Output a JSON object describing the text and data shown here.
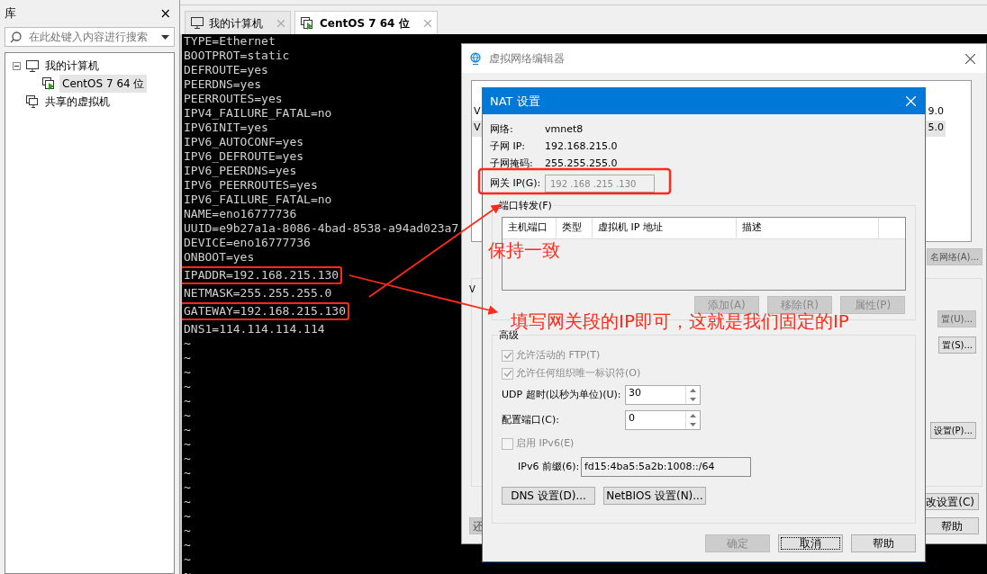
{
  "library": {
    "title": "库",
    "close": "×",
    "search_placeholder": "在此处键入内容进行搜索",
    "tree": [
      {
        "label": "我的计算机",
        "kind": "computer",
        "expanded": true,
        "selected": false,
        "children": [
          {
            "label": "CentOS 7 64 位",
            "kind": "vm",
            "selected": true
          }
        ]
      },
      {
        "label": "共享的虚拟机",
        "kind": "shared",
        "selected": false
      }
    ]
  },
  "tabs": [
    {
      "label": "我的计算机",
      "kind": "computer",
      "selected": false
    },
    {
      "label": "CentOS 7 64 位",
      "kind": "vm",
      "selected": true
    }
  ],
  "terminal": {
    "lines": [
      "TYPE=Ethernet",
      "BOOTPROT=static",
      "DEFROUTE=yes",
      "PEERDNS=yes",
      "PEERROUTES=yes",
      "IPV4_FAILURE_FATAL=no",
      "IPV6INIT=yes",
      "IPV6_AUTOCONF=yes",
      "IPV6_DEFROUTE=yes",
      "IPV6_PEERDNS=yes",
      "IPV6_PEERROUTES=yes",
      "IPV6_FAILURE_FATAL=no",
      "NAME=eno16777736",
      "UUID=e9b27a1a-8086-4bad-8538-a94ad023a7",
      "DEVICE=eno16777736",
      "ONBOOT=yes",
      {
        "text": "IPADDR=192.168.215.130",
        "highlighted": true
      },
      "NETMASK=255.255.255.0",
      {
        "text": "GATEWAY=192.168.215.130",
        "highlighted": true
      },
      "DNS1=114.114.114.114",
      "~",
      "~",
      "~",
      "~",
      "~",
      "~",
      "~",
      "~",
      "~",
      "~",
      "~",
      "~",
      "~",
      "~",
      "~",
      "~",
      "~"
    ]
  },
  "network_editor": {
    "title": "虚拟网络编辑器",
    "rows": [
      {
        "column_1": "V",
        "column_2": "9.0",
        "selected": false
      },
      {
        "column_1": "V",
        "column_2": "5.0",
        "selected": true
      }
    ],
    "rename_button": "名网络(A)...",
    "group_label": "V",
    "side_buttons": [
      "置(U)...",
      "置(S)...",
      "设置(P)..."
    ],
    "change_button": "改设置(C)",
    "help_button": "帮助",
    "restore_button": "还"
  },
  "nat_dialog": {
    "title": "NAT 设置",
    "info": [
      {
        "label": "网络:",
        "value": "vmnet8"
      },
      {
        "label": "子网 IP:",
        "value": "192.168.215.0"
      },
      {
        "label": "子网掩码:",
        "value": "255.255.255.0"
      }
    ],
    "gateway_label": "网关 IP(G):",
    "gateway_value": "192 .168 .215 .130",
    "forwarding_label": "端口转发(F)",
    "columns": [
      "主机端口",
      "类型",
      "虚拟机 IP 地址",
      "描述"
    ],
    "forwarding_buttons": [
      {
        "label": "添加(A)",
        "disabled": true
      },
      {
        "label": "移除(R)",
        "disabled": true
      },
      {
        "label": "属性(P)",
        "disabled": true
      }
    ],
    "advanced_label": "高级",
    "options": [
      {
        "label": "允许活动的 FTP(T)",
        "checked": true,
        "disabled": true
      },
      {
        "label": "允许任何组织唯一标识符(O)",
        "checked": true,
        "disabled": true
      }
    ],
    "spinners": [
      {
        "label": "UDP 超时(以秒为单位)(U):",
        "value": "30"
      },
      {
        "label": "配置端口(C):",
        "value": "0"
      }
    ],
    "ipv6": {
      "label": "启用 IPv6(E)",
      "checked": false,
      "disabled": true
    },
    "prefix_label": "IPv6 前缀(6):",
    "prefix_value": "fd15:4ba5:5a2b:1008::/64",
    "setting_buttons": [
      "DNS 设置(D)...",
      "NetBIOS 设置(N)..."
    ],
    "footer_buttons": [
      {
        "label": "确定",
        "disabled": true,
        "focused": false
      },
      {
        "label": "取消",
        "disabled": false,
        "focused": true
      },
      {
        "label": "帮助",
        "disabled": false,
        "focused": false
      }
    ]
  },
  "annotations": [
    "保持一致",
    "填写网关段的IP即可，这就是我们固定的IP"
  ]
}
